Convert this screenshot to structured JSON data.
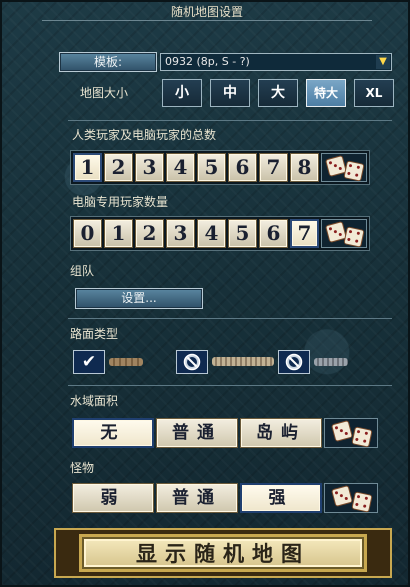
{
  "window": {
    "title": "随机地图设置"
  },
  "template": {
    "label": "模板:",
    "value": "0932 (8p, S - ?)",
    "arrow_icon": "double-chevron-down-icon"
  },
  "map_size": {
    "label": "地图大小",
    "options": [
      "小",
      "中",
      "大",
      "特大",
      "XL"
    ],
    "selected_index": 3
  },
  "total_players": {
    "label": "人类玩家及电脑玩家的总数",
    "options": [
      "1",
      "2",
      "3",
      "4",
      "5",
      "6",
      "7",
      "8"
    ],
    "selected_index": 0,
    "random_icon": "dice-icon"
  },
  "computer_players": {
    "label": "电脑专用玩家数量",
    "options": [
      "0",
      "1",
      "2",
      "3",
      "4",
      "5",
      "6",
      "7"
    ],
    "selected_index": 7,
    "random_icon": "dice-icon"
  },
  "teams": {
    "label": "组队",
    "settings_button": "设置..."
  },
  "road_types": {
    "label": "路面类型",
    "items": [
      {
        "state": "checked",
        "road": "dirt",
        "color": "#a08460"
      },
      {
        "state": "disabled",
        "road": "gravel",
        "color": "#b8a890"
      },
      {
        "state": "disabled",
        "road": "cobblestone",
        "color": "#8c949c"
      }
    ]
  },
  "water": {
    "label": "水域面积",
    "options": [
      "无",
      "普通",
      "岛屿"
    ],
    "selected_index": 0,
    "random_icon": "dice-icon"
  },
  "monsters": {
    "label": "怪物",
    "options": [
      "弱",
      "普通",
      "强"
    ],
    "selected_index": 2,
    "random_icon": "dice-icon"
  },
  "show_map_button": "显示随机地图"
}
